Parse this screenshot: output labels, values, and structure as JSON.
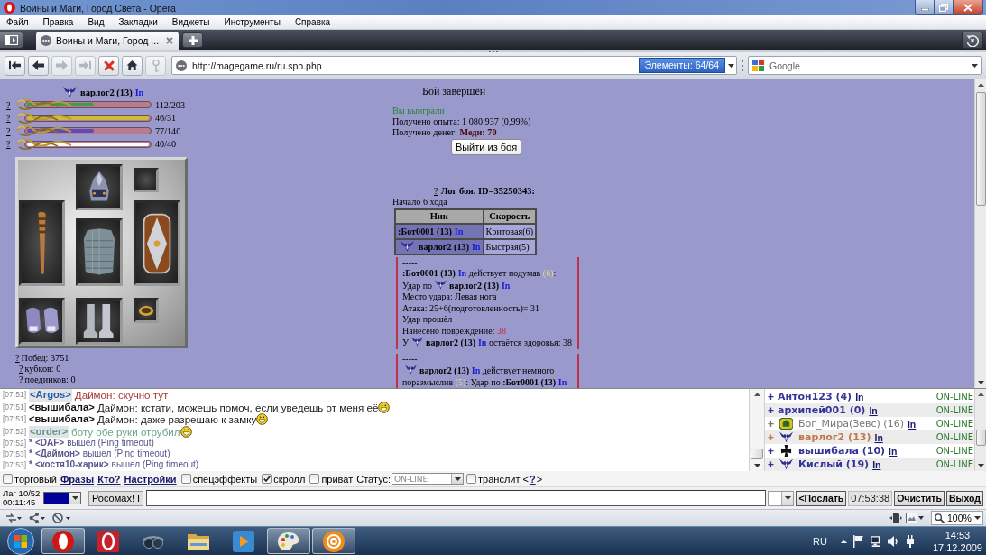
{
  "window": {
    "title": "Воины и Маги, Город Света - Opera"
  },
  "menu": [
    "Файл",
    "Правка",
    "Вид",
    "Закладки",
    "Виджеты",
    "Инструменты",
    "Справка"
  ],
  "tabs": [
    {
      "label": "Воины и Маги, Город ...",
      "selected": true
    }
  ],
  "nav_buttons": [
    {
      "kind": "rewind",
      "disabled": false
    },
    {
      "kind": "back",
      "disabled": false
    },
    {
      "kind": "forward",
      "disabled": true
    },
    {
      "kind": "fast_forward",
      "disabled": true
    },
    {
      "kind": "stop",
      "disabled": false
    },
    {
      "kind": "home",
      "disabled": false
    },
    {
      "kind": "key",
      "disabled": true
    }
  ],
  "address": {
    "url": "http://magegame.ru/ru.spb.php",
    "badge": "Элементы: 64/64"
  },
  "search": {
    "placeholder": "Google"
  },
  "character": {
    "name": "варлог2 (13)",
    "link": "In",
    "bars": [
      {
        "help": "?",
        "color": "#3e9a4e",
        "level": 0.55,
        "reading": "112/203"
      },
      {
        "help": "?",
        "color": "#cdbb3a",
        "level": 1,
        "reading": "46/31"
      },
      {
        "help": "?",
        "color": "#5a4cc0",
        "level": 0.55,
        "reading": "77/140"
      },
      {
        "help": "?",
        "color": "#ffffff",
        "level": 1,
        "reading": "40/40"
      }
    ],
    "slots": [
      {
        "kind": "helmet"
      },
      {
        "kind": "empty"
      },
      {
        "kind": "club"
      },
      {
        "kind": "armor"
      },
      {
        "kind": "shield"
      },
      {
        "kind": "gloves"
      },
      {
        "kind": "boots"
      },
      {
        "kind": "ring"
      }
    ],
    "stats": [
      {
        "help": "?",
        "text": "Побед: 3751"
      },
      {
        "help": "?",
        "text": "кубков: 0"
      },
      {
        "help": "?",
        "text": "поединков: 0"
      }
    ]
  },
  "battle": {
    "title": "Бой завершён",
    "result": "Вы выиграли",
    "rewards": [
      "Получено опыта: 1 080 937 (0,99%)",
      "Получено денег: **Меди: 70**"
    ],
    "exit_button": "Выйти из боя",
    "log_help": "?",
    "log_title": "Лог боя. ID=35250343:",
    "round": "Начало 6 хода",
    "table": {
      "columns": [
        "Ник",
        "Скорость"
      ],
      "rows": [
        {
          "emblem": false,
          "name": ":Бот0001 (13)",
          "link": "In",
          "speed": "Критовая(6)"
        },
        {
          "emblem": true,
          "name": "варлог2 (13)",
          "link": "In",
          "speed": "Быстрая(5)"
        }
      ]
    },
    "entries": [
      {
        "separator": "-----",
        "lines": [
          [
            {
              "kind": "name",
              "text": ":Бот0001 (13)"
            },
            {
              "kind": "link",
              "text": "In"
            },
            {
              "kind": "text",
              "text": " действует подумав "
            },
            {
              "kind": "pause",
              "text": "(6)"
            },
            {
              "kind": "text",
              "text": ":"
            }
          ],
          [
            {
              "kind": "text",
              "text": "Удар по"
            },
            {
              "kind": "emblem"
            },
            {
              "kind": "name",
              "text": "варлог2 (13)"
            },
            {
              "kind": "link",
              "text": "In"
            }
          ],
          [
            {
              "kind": "text",
              "text": "Место удара: Левая нога"
            }
          ],
          [
            {
              "kind": "text",
              "text": "Атака: 25+6(подготовленность)= 31"
            }
          ],
          [
            {
              "kind": "text",
              "text": "Удар прошёл"
            }
          ],
          [
            {
              "kind": "text",
              "text": "Нанесено повреждение: "
            },
            {
              "kind": "damage",
              "text": "38"
            }
          ],
          [
            {
              "kind": "text",
              "text": "У"
            },
            {
              "kind": "emblem"
            },
            {
              "kind": "name",
              "text": "варлог2 (13)"
            },
            {
              "kind": "link",
              "text": "In"
            },
            {
              "kind": "text",
              "text": " остаётся здоровья: 38"
            }
          ]
        ]
      },
      {
        "separator": "-----",
        "lines": [
          [
            {
              "kind": "emblem"
            },
            {
              "kind": "name",
              "text": "варлог2 (13)"
            },
            {
              "kind": "link",
              "text": "In"
            },
            {
              "kind": "text",
              "text": " действует немного поразмыслив "
            },
            {
              "kind": "pause",
              "text": "(5)"
            },
            {
              "kind": "text",
              "text": ": Удар по "
            },
            {
              "kind": "name",
              "text": ":Бот0001 (13)"
            },
            {
              "kind": "link",
              "text": "In"
            }
          ]
        ]
      }
    ]
  },
  "chat": {
    "messages": [
      {
        "kind": "message",
        "time": "[07:51]",
        "nick": {
          "text": "<Argos>",
          "color": "#2c5d9c",
          "marked": true
        },
        "message": {
          "text": "Даймон: скучно тут",
          "color": "#a53a3a"
        },
        "smiley": false
      },
      {
        "kind": "message",
        "time": "[07:51]",
        "nick": {
          "text": "<вышибала>",
          "color": "#111111",
          "marked": false
        },
        "message": {
          "text": "Даймон: кстати, можешь помоч, если уведешь от меня её",
          "color": "#1a1a1a"
        },
        "smiley": true
      },
      {
        "kind": "message",
        "time": "[07:51]",
        "nick": {
          "text": "<вышибала>",
          "color": "#111111",
          "marked": false
        },
        "message": {
          "text": "Даймон: даже разрешаю к замку",
          "color": "#1a1a1a"
        },
        "smiley": true
      },
      {
        "kind": "message",
        "time": "[07:52]",
        "nick": {
          "text": "<order>",
          "color": "#5c9a7a",
          "marked": true
        },
        "message": {
          "text": "боту обе руки отрубил",
          "color": "#6aa58a"
        },
        "smiley": true
      },
      {
        "kind": "system",
        "time": "[07:52]",
        "mark": "*",
        "nick": {
          "text": "<DAF>",
          "color": "#55558a",
          "marked": false
        },
        "message": {
          "text": "вышел (Ping timeout)",
          "color": "#55558a"
        },
        "smiley": false
      },
      {
        "kind": "system",
        "time": "[07:53]",
        "mark": "*",
        "nick": {
          "text": "<Даймон>",
          "color": "#55558a",
          "marked": false
        },
        "message": {
          "text": "вышел (Ping timeout)",
          "color": "#55558a"
        },
        "smiley": false
      },
      {
        "kind": "system",
        "time": "[07:53]",
        "mark": "*",
        "nick": {
          "text": "<костя10-харик>",
          "color": "#55558a",
          "marked": false
        },
        "message": {
          "text": "вышел (Ping timeout)",
          "color": "#55558a"
        },
        "smiley": false
      }
    ]
  },
  "online": [
    {
      "plus": "+",
      "name": "Антон123 (4)",
      "color": "#333399",
      "bold": true,
      "link": "In",
      "status": "ON-LINE"
    },
    {
      "plus": "+",
      "name": "архипей001 (0)",
      "color": "#333399",
      "bold": true,
      "link": "In",
      "status": "ON-LINE"
    },
    {
      "plus": "+",
      "emblem": {
        "kind": "badge"
      },
      "name": "Бог_Мира(Зевс) (16)",
      "color": "#777777",
      "bold": false,
      "link": "In",
      "status": "ON-LINE"
    },
    {
      "plus": "+",
      "emblem": {
        "kind": "wings"
      },
      "name": "варлог2 (13)",
      "color": "#c07848",
      "bold": true,
      "link": "In",
      "status": "ON-LINE"
    },
    {
      "plus": "+",
      "emblem": {
        "kind": "cross"
      },
      "name": "вышибала (10)",
      "color": "#333399",
      "bold": true,
      "link": "In",
      "status": "ON-LINE"
    },
    {
      "plus": "+",
      "emblem": {
        "kind": "wings"
      },
      "name": "Кислый (19)",
      "color": "#333399",
      "bold": true,
      "link": "In",
      "status": "ON-LINE"
    }
  ],
  "options": [
    {
      "kind": "checkbox",
      "label": "торговый",
      "checked": false
    },
    {
      "kind": "link",
      "label": "Фразы"
    },
    {
      "kind": "link",
      "label": "Кто?"
    },
    {
      "kind": "link",
      "label": "Настройки"
    },
    {
      "kind": "checkbox",
      "label": "спецэффекты",
      "checked": false
    },
    {
      "kind": "checkbox",
      "label": "скролл",
      "checked": true
    },
    {
      "kind": "checkbox",
      "label": "приват",
      "checked": false
    },
    {
      "kind": "select",
      "label": "Статус:",
      "value": "ON-LINE"
    },
    {
      "kind": "checkbox",
      "label": "транслит",
      "checked": false
    },
    {
      "kind": "help",
      "before": "<",
      "label": "?",
      "after": ">"
    }
  ],
  "input_bar": {
    "lag": "Лаг 10/52",
    "timer": "00:11:45",
    "color": "#000099",
    "prefix": "Росомах! I",
    "buttons": [
      {
        "kind": "button",
        "label": "<Послать"
      },
      {
        "kind": "clock",
        "label": "07:53:38"
      },
      {
        "kind": "button",
        "label": "Очистить"
      },
      {
        "kind": "button",
        "label": "Выход"
      }
    ]
  },
  "status_bar": {
    "zoom": "100%"
  },
  "taskbar": {
    "apps": [
      {
        "kind": "red_ring",
        "running": true
      },
      {
        "kind": "red_tile",
        "running": false
      },
      {
        "kind": "goggles",
        "running": false
      },
      {
        "kind": "folder",
        "running": false
      },
      {
        "kind": "play",
        "running": false
      },
      {
        "kind": "palette",
        "running": true
      },
      {
        "kind": "at_sign",
        "running": true
      }
    ],
    "language": "RU",
    "time": "14:53",
    "date": "17.12.2009"
  }
}
